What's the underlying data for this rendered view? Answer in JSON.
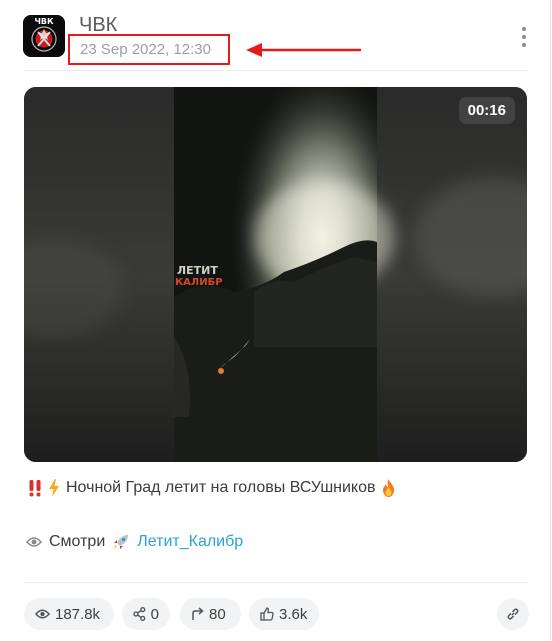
{
  "channel": {
    "name": "ЧВК",
    "date": "23 Sep 2022, 12:30",
    "avatar_text": "ЧВК"
  },
  "video": {
    "duration": "00:16",
    "overlay_text": [
      "ЛЕТИТ",
      "КАЛИБР"
    ]
  },
  "message": {
    "text": "Ночной Град летит на головы ВСУшников",
    "prefix_emojis": [
      "double-exclamation",
      "lightning"
    ],
    "suffix_emoji": "fire"
  },
  "tags": {
    "label": "Смотри",
    "hashtag": "Летит_Калибр"
  },
  "stats": {
    "views": "187.8k",
    "shares": "0",
    "forwards": "80",
    "likes": "3.6k"
  },
  "colors": {
    "annotation_red": "#e01c1c",
    "link": "#2aa3d6",
    "chip_bg": "#f2f3f5"
  }
}
